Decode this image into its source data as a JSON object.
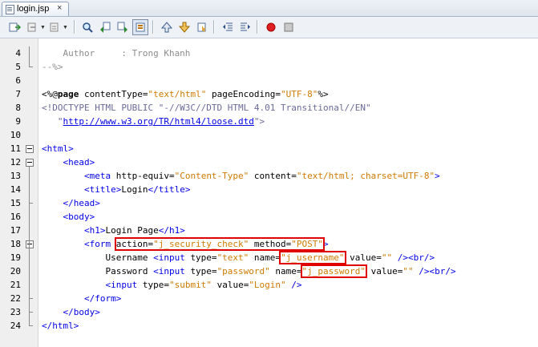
{
  "tab": {
    "label": "login.jsp",
    "close": "×"
  },
  "toolbar": {
    "buttons": [
      "back-icon",
      "forward-icon",
      "last-edit-icon",
      "find-icon",
      "find-previous-icon",
      "find-next-icon",
      "toggle-highlight-icon",
      "previous-bookmark-icon",
      "next-bookmark-icon",
      "toggle-bookmark-icon",
      "shift-left-icon",
      "shift-right-icon",
      "record-macro-icon",
      "stop-macro-icon"
    ]
  },
  "editor": {
    "line_numbers": [
      "4",
      "5",
      "6",
      "7",
      "8",
      "9",
      "10",
      "11",
      "12",
      "13",
      "14",
      "15",
      "16",
      "17",
      "18",
      "19",
      "20",
      "21",
      "22",
      "23",
      "24"
    ],
    "lines": [
      [
        {
          "t": "    Author     : Trong Khanh",
          "c": "cmt"
        }
      ],
      [
        {
          "t": "--%>",
          "c": "cmt"
        }
      ],
      [],
      [
        {
          "t": "<%@",
          "c": "dir"
        },
        {
          "t": "page",
          "c": "dkw"
        },
        {
          "t": " contentType=",
          "c": "attr"
        },
        {
          "t": "\"text/html\"",
          "c": "str"
        },
        {
          "t": " pageEncoding=",
          "c": "attr"
        },
        {
          "t": "\"UTF-8\"",
          "c": "str"
        },
        {
          "t": "%>",
          "c": "dir"
        }
      ],
      [
        {
          "t": "<!DOCTYPE HTML PUBLIC \"-//W3C//DTD HTML 4.01 Transitional//EN\"",
          "c": "doc"
        }
      ],
      [
        {
          "t": "   \"",
          "c": "doc"
        },
        {
          "t": "http://www.w3.org/TR/html4/loose.dtd",
          "c": "url"
        },
        {
          "t": "\">",
          "c": "doc"
        }
      ],
      [],
      [
        {
          "t": "<html>",
          "c": "tag"
        }
      ],
      [
        {
          "t": "    <head>",
          "c": "tag"
        }
      ],
      [
        {
          "t": "        <meta ",
          "c": "tag"
        },
        {
          "t": "http-equiv=",
          "c": "attr"
        },
        {
          "t": "\"Content-Type\"",
          "c": "str"
        },
        {
          "t": " content=",
          "c": "attr"
        },
        {
          "t": "\"text/html; charset=UTF-8\"",
          "c": "str"
        },
        {
          "t": ">",
          "c": "tag"
        }
      ],
      [
        {
          "t": "        <title>",
          "c": "tag"
        },
        {
          "t": "Login",
          "c": "attr"
        },
        {
          "t": "</title>",
          "c": "tag"
        }
      ],
      [
        {
          "t": "    </head>",
          "c": "tag"
        }
      ],
      [
        {
          "t": "    <body>",
          "c": "tag"
        }
      ],
      [
        {
          "t": "        <h1>",
          "c": "tag"
        },
        {
          "t": "Login Page",
          "c": "attr"
        },
        {
          "t": "</h1>",
          "c": "tag"
        }
      ],
      [
        {
          "t": "        <form ",
          "c": "tag"
        },
        {
          "t": "action=",
          "c": "attr",
          "h": "a"
        },
        {
          "t": "\"j_security_check\"",
          "c": "str",
          "h": "a"
        },
        {
          "t": " method=",
          "c": "attr",
          "h": "a"
        },
        {
          "t": "\"POST\"",
          "c": "str",
          "h": "a"
        },
        {
          "t": ">",
          "c": "tag"
        }
      ],
      [
        {
          "t": "            Username ",
          "c": "attr"
        },
        {
          "t": "<input ",
          "c": "tag"
        },
        {
          "t": "type=",
          "c": "attr"
        },
        {
          "t": "\"text\"",
          "c": "str"
        },
        {
          "t": " name=",
          "c": "attr"
        },
        {
          "t": "\"j_username\"",
          "c": "str",
          "h": "b"
        },
        {
          "t": " value=",
          "c": "attr"
        },
        {
          "t": "\"\"",
          "c": "str"
        },
        {
          "t": " /><br/>",
          "c": "tag"
        }
      ],
      [
        {
          "t": "            Password ",
          "c": "attr"
        },
        {
          "t": "<input ",
          "c": "tag"
        },
        {
          "t": "type=",
          "c": "attr"
        },
        {
          "t": "\"password\"",
          "c": "str"
        },
        {
          "t": " name=",
          "c": "attr"
        },
        {
          "t": "\"j_password\"",
          "c": "str",
          "h": "c"
        },
        {
          "t": " value=",
          "c": "attr"
        },
        {
          "t": "\"\"",
          "c": "str"
        },
        {
          "t": " /><br/>",
          "c": "tag"
        }
      ],
      [
        {
          "t": "            <input ",
          "c": "tag"
        },
        {
          "t": "type=",
          "c": "attr"
        },
        {
          "t": "\"submit\"",
          "c": "str"
        },
        {
          "t": " value=",
          "c": "attr"
        },
        {
          "t": "\"Login\"",
          "c": "str"
        },
        {
          "t": " />",
          "c": "tag"
        }
      ],
      [
        {
          "t": "        </form>",
          "c": "tag"
        }
      ],
      [
        {
          "t": "    </body>",
          "c": "tag"
        }
      ],
      [
        {
          "t": "</html>",
          "c": "tag"
        }
      ]
    ]
  }
}
